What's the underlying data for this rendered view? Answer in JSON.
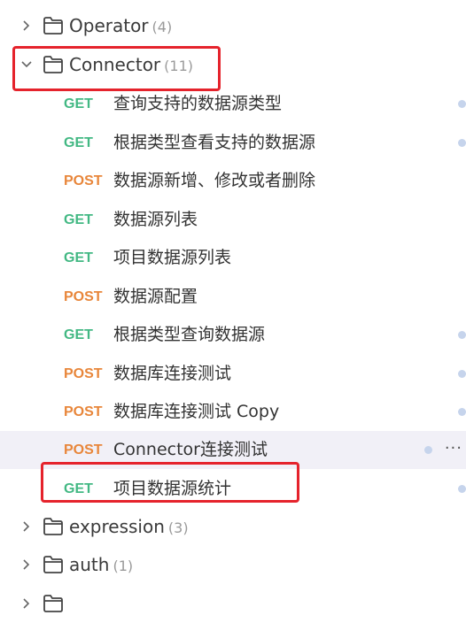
{
  "tree": {
    "folders_top": [
      {
        "name": "Operator",
        "count": "(4)",
        "expanded": false,
        "icon": "folder-icon"
      }
    ],
    "connector": {
      "name": "Connector",
      "count": "(11)",
      "expanded": true,
      "requests": [
        {
          "method": "GET",
          "title": "查询支持的数据源类型"
        },
        {
          "method": "GET",
          "title": "根据类型查看支持的数据源"
        },
        {
          "method": "POST",
          "title": "数据源新增、修改或者删除"
        },
        {
          "method": "GET",
          "title": "数据源列表"
        },
        {
          "method": "GET",
          "title": "项目数据源列表"
        },
        {
          "method": "POST",
          "title": "数据源配置"
        },
        {
          "method": "GET",
          "title": "根据类型查询数据源"
        },
        {
          "method": "POST",
          "title": "数据库连接测试"
        },
        {
          "method": "POST",
          "title": "数据库连接测试 Copy"
        },
        {
          "method": "POST",
          "title": "Connector连接测试"
        },
        {
          "method": "GET",
          "title": "项目数据源统计"
        }
      ]
    },
    "folders_bottom": [
      {
        "name": "expression",
        "count": "(3)",
        "expanded": false
      },
      {
        "name": "auth",
        "count": "(1)",
        "expanded": false
      }
    ],
    "more_label": "···"
  },
  "colors": {
    "get": "#42b883",
    "post": "#e8863a",
    "highlight_box": "#e5232c",
    "active_row": "#f1f0f7"
  }
}
